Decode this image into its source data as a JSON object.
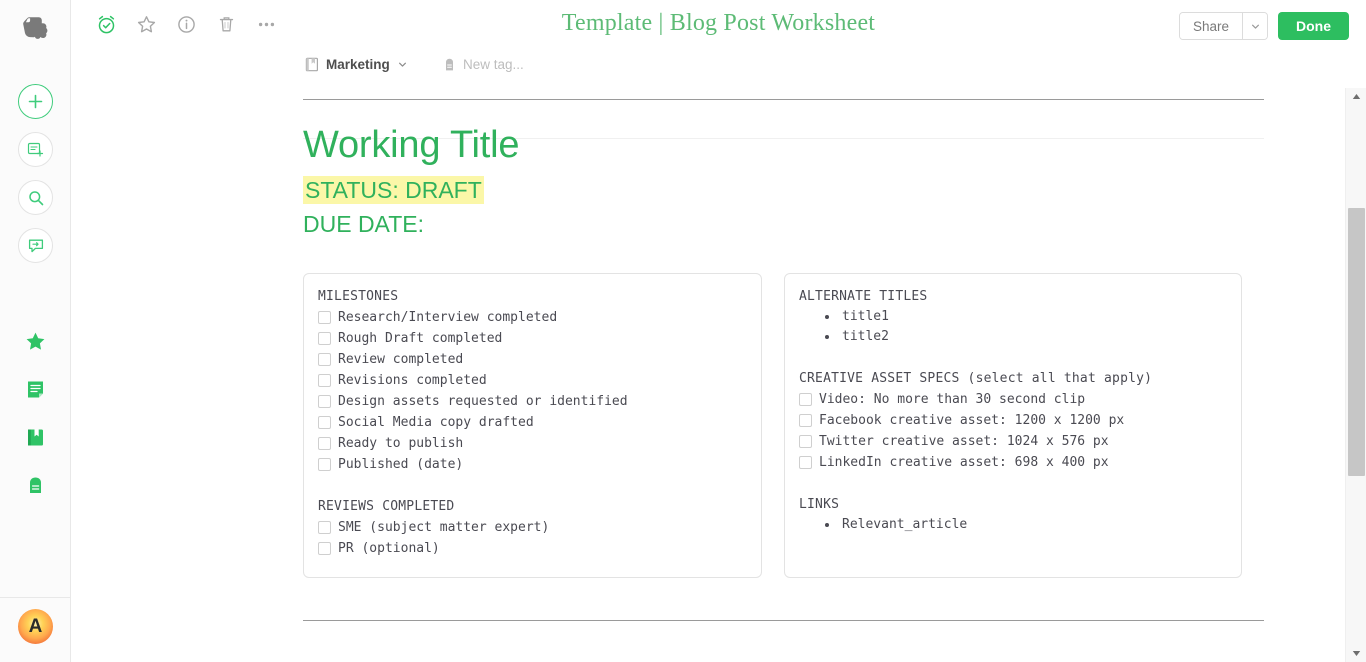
{
  "app": {
    "name": "Evernote",
    "logo_icon": "evernote-elephant-icon"
  },
  "sidebar": {
    "actions": [
      {
        "name": "new-note-button",
        "icon": "plus-icon"
      },
      {
        "name": "new-notebook-button",
        "icon": "note-add-icon"
      },
      {
        "name": "search-button",
        "icon": "magnifier-icon"
      },
      {
        "name": "share-note-button",
        "icon": "share-chat-icon"
      }
    ],
    "nav": [
      {
        "name": "shortcuts-item",
        "icon": "star-icon"
      },
      {
        "name": "notes-item",
        "icon": "note-icon"
      },
      {
        "name": "notebooks-item",
        "icon": "notebook-icon"
      },
      {
        "name": "tags-item",
        "icon": "tag-icon"
      }
    ],
    "avatar_initial": "A"
  },
  "toolbar": {
    "icons": [
      {
        "name": "reminder-icon",
        "label": "Reminder"
      },
      {
        "name": "favorite-star-icon",
        "label": "Favorite"
      },
      {
        "name": "info-icon",
        "label": "Note info"
      },
      {
        "name": "trash-icon",
        "label": "Delete"
      },
      {
        "name": "more-options-icon",
        "label": "More"
      }
    ],
    "share_label": "Share",
    "share_caret_icon": "chevron-down-icon",
    "done_label": "Done"
  },
  "note": {
    "title": "Template | Blog Post Worksheet",
    "notebook": "Marketing",
    "notebook_icon": "notebook-icon",
    "notebook_caret_icon": "chevron-down-icon",
    "tag_icon": "tag-icon",
    "tag_placeholder": "New tag..."
  },
  "document": {
    "heading": "Working Title",
    "status_line": "STATUS: DRAFT",
    "status_highlight_color": "#fbf7a8",
    "due_line": "DUE DATE:",
    "heading_color": "#30b15c",
    "left_cell": {
      "milestones_header": "MILESTONES",
      "milestones": [
        "Research/Interview completed",
        "Rough Draft completed",
        "Review completed",
        "Revisions completed",
        "Design assets requested or identified",
        "Social Media copy drafted",
        "Ready to publish",
        "Published (date)"
      ],
      "reviews_header": "REVIEWS COMPLETED",
      "reviews": [
        "SME (subject matter expert)",
        "PR (optional)"
      ]
    },
    "right_cell": {
      "alternate_titles_header": "ALTERNATE TITLES",
      "alternate_titles": [
        "title1",
        "title2"
      ],
      "creative_header": "CREATIVE ASSET SPECS (select all that apply)",
      "creative_items": [
        "Video: No more than 30 second clip",
        "Facebook creative asset: 1200 x 1200 px",
        "Twitter creative asset: 1024 x 576 px",
        "LinkedIn creative asset: 698 x 400 px"
      ],
      "links_header": "LINKS",
      "links": [
        "Relevant_article"
      ]
    }
  },
  "scrollbar": {
    "up_icon": "scroll-up-arrow-icon",
    "down_icon": "scroll-down-arrow-icon"
  }
}
